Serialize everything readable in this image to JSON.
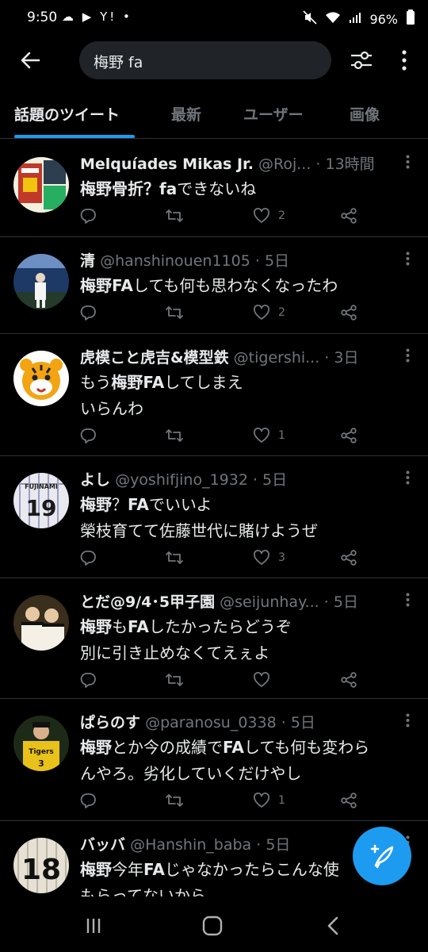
{
  "status_bar": {
    "time": "9:50",
    "left_icons": [
      "cloud-icon",
      "youtube-icon",
      "yahoo-icon",
      "dot-icon"
    ],
    "left_icons_text": "☁ ▶ Y! •",
    "right_icons": [
      "mute-icon",
      "wifi-icon",
      "signal-icon"
    ],
    "battery": "96%"
  },
  "header": {
    "search_query": "梅野 fa"
  },
  "tabs": [
    {
      "label": "話題のツイート",
      "active": true
    },
    {
      "label": "最新",
      "active": false
    },
    {
      "label": "ユーザー",
      "active": false
    },
    {
      "label": "画像",
      "active": false
    }
  ],
  "tweets": [
    {
      "name": "Melquíades Mikas Jr.",
      "handle": "@Roj...",
      "time": "13時間",
      "lines": [
        [
          {
            "t": "梅野骨折？",
            "b": true
          },
          {
            "t": "fa",
            "b": true
          },
          {
            "t": "できないね",
            "b": false
          }
        ]
      ],
      "reply_count": "",
      "retweet_count": "",
      "like_count": "2",
      "avatar": "shouts"
    },
    {
      "name": "清",
      "handle": "@hanshinouen1105",
      "time": "5日",
      "lines": [
        [
          {
            "t": "梅野FA",
            "b": true
          },
          {
            "t": "しても何も思わなくなったわ",
            "b": false
          }
        ]
      ],
      "reply_count": "",
      "retweet_count": "",
      "like_count": "2",
      "avatar": "stadium"
    },
    {
      "name": "虎模こと虎吉&模型鉄",
      "handle": "@tigershi...",
      "time": "3日",
      "lines": [
        [
          {
            "t": "もう",
            "b": false
          },
          {
            "t": "梅野FA",
            "b": true
          },
          {
            "t": "してしまえ",
            "b": false
          }
        ],
        [
          {
            "t": "いらんわ",
            "b": false
          }
        ]
      ],
      "reply_count": "",
      "retweet_count": "",
      "like_count": "1",
      "avatar": "tiger"
    },
    {
      "name": "よし",
      "handle": "@yoshifjino_1932",
      "time": "5日",
      "lines": [
        [
          {
            "t": "梅野",
            "b": true
          },
          {
            "t": "？",
            "b": false
          },
          {
            "t": "FA",
            "b": true
          },
          {
            "t": "でいいよ",
            "b": false
          }
        ],
        [
          {
            "t": "榮枝育てて佐藤世代に賭けようぜ",
            "b": false
          }
        ]
      ],
      "reply_count": "",
      "retweet_count": "",
      "like_count": "3",
      "avatar": "jersey19"
    },
    {
      "name": "とだ@9/4･5甲子園",
      "handle": "@seijunhay...",
      "time": "5日",
      "lines": [
        [
          {
            "t": "梅野",
            "b": true
          },
          {
            "t": "も",
            "b": false
          },
          {
            "t": "FA",
            "b": true
          },
          {
            "t": "したかったらどうぞ",
            "b": false
          }
        ],
        [
          {
            "t": "別に引き止めなくてえぇよ",
            "b": false
          }
        ]
      ],
      "reply_count": "",
      "retweet_count": "",
      "like_count": "",
      "avatar": "players"
    },
    {
      "name": "ぱらのす",
      "handle": "@paranosu_0338",
      "time": "5日",
      "lines": [
        [
          {
            "t": "梅野",
            "b": true
          },
          {
            "t": "とか今の成績で",
            "b": false
          },
          {
            "t": "FA",
            "b": true
          },
          {
            "t": "しても何も変わら",
            "b": false
          }
        ],
        [
          {
            "t": "んやろ。劣化していくだけやし",
            "b": false
          }
        ]
      ],
      "reply_count": "",
      "retweet_count": "",
      "like_count": "1",
      "avatar": "tigers-player"
    },
    {
      "name": "バッバ",
      "handle": "@Hanshin_baba",
      "time": "5日",
      "lines": [
        [
          {
            "t": "梅野",
            "b": true
          },
          {
            "t": "今年",
            "b": false
          },
          {
            "t": "FA",
            "b": true
          },
          {
            "t": "じゃなかったらこんな使",
            "b": false
          }
        ],
        [
          {
            "t": "もらってないから",
            "b": false
          }
        ]
      ],
      "reply_count": "",
      "retweet_count": "",
      "like_count": "",
      "avatar": "number18"
    }
  ],
  "colors": {
    "background": "#000000",
    "accent": "#1d9bf0",
    "text": "#e7e9ea",
    "muted": "#71767b",
    "divider": "#2f3336"
  },
  "icons": {
    "back": "arrow-left-icon",
    "filter": "sliders-icon",
    "more": "kebab-icon",
    "compose": "compose-tweet-icon",
    "nav": [
      "recent-apps-icon",
      "home-icon",
      "back-icon"
    ]
  }
}
